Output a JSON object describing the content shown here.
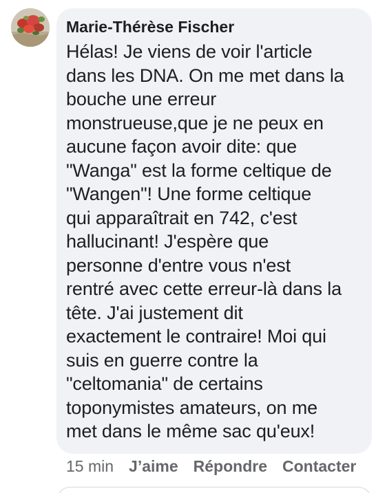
{
  "comment": {
    "author": "Marie-Thérèse Fischer",
    "avatar_icon": "profile-photo-red-flowers",
    "lines": [
      "Hélas! Je viens de voir l'article",
      "dans les DNA. On me met dans la",
      "bouche une erreur",
      "monstrueuse,que je ne peux en",
      "aucune façon avoir dite: que",
      "\"Wanga\" est la forme celtique de",
      "\"Wangen\"! Une forme celtique",
      "qui apparaîtrait en 742, c'est",
      "hallucinant! J'espère que",
      "personne d'entre vous n'est",
      "rentré avec cette erreur-là dans la",
      "tête. J'ai justement dit",
      "exactement le contraire! Moi qui",
      "suis en guerre contre la",
      "\"celtomania\" de certains",
      "toponymistes amateurs, on me",
      "met dans le même sac qu'eux!"
    ]
  },
  "actions": {
    "time": "15 min",
    "like": "J’aime",
    "reply": "Répondre",
    "contact": "Contacter"
  },
  "colors": {
    "bubble": "#f1f2f6",
    "text": "#1c1e21",
    "secondary": "#65676b"
  }
}
